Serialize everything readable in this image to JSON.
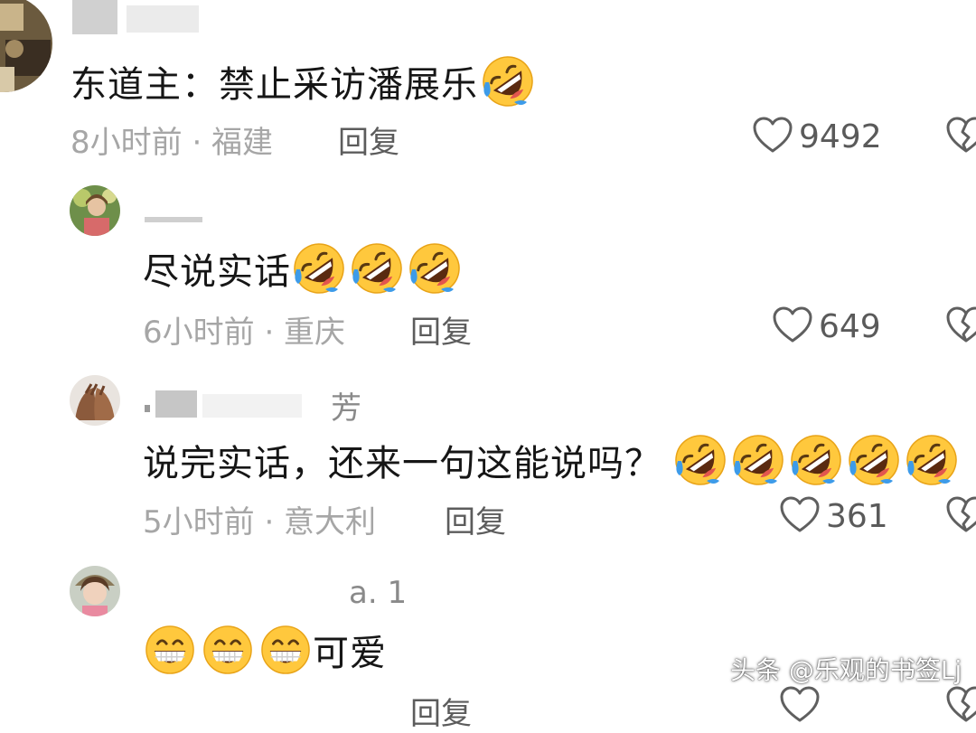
{
  "comments": [
    {
      "username": "",
      "text": "东道主：禁止采访潘展乐",
      "meta": "8小时前 · 福建",
      "reply_label": "回复",
      "likes": "9492",
      "emoji_count": 1
    },
    {
      "username": "",
      "text": "尽说实话",
      "meta": "6小时前 · 重庆",
      "reply_label": "回复",
      "likes": "649",
      "emoji_count": 3
    },
    {
      "username": "芳",
      "text": "说完实话，还来一句这能说吗？",
      "meta": "5小时前 · 意大利",
      "reply_label": "回复",
      "likes": "361",
      "emoji_count": 5
    },
    {
      "username": "a. 1",
      "text": "可爱",
      "meta": "",
      "reply_label": "回复",
      "likes": "",
      "emoji_count": 3
    }
  ],
  "icons": {
    "laugh": "rolling-on-floor-laughing-icon",
    "grin": "grinning-face-icon",
    "like": "heart-icon",
    "dislike": "broken-heart-icon"
  },
  "watermark": "头条 @乐观的书签Lj",
  "colors": {
    "emoji_yellow": "#FFC83D",
    "tear_blue": "#3D9BE9",
    "meta_gray": "#A6A6A6"
  }
}
